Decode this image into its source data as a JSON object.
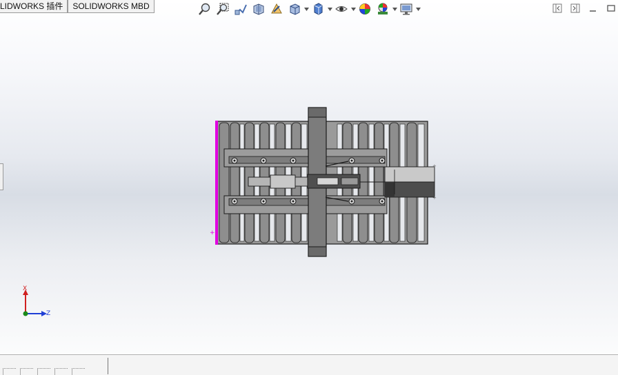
{
  "tabs": [
    {
      "label": "LIDWORKS 插件"
    },
    {
      "label": "SOLIDWORKS MBD"
    }
  ],
  "heads_up_toolbar": {
    "buttons": [
      {
        "icon": "zoom-to-fit-icon"
      },
      {
        "icon": "zoom-to-area-icon"
      },
      {
        "icon": "previous-view-icon"
      },
      {
        "icon": "section-view-icon"
      },
      {
        "icon": "dynamic-annotation-views-icon"
      },
      {
        "icon": "view-orientation-icon"
      },
      {
        "icon": "display-style-icon"
      },
      {
        "icon": "hide-show-items-icon"
      },
      {
        "icon": "edit-appearance-icon"
      },
      {
        "icon": "apply-scene-icon"
      },
      {
        "icon": "view-settings-icon"
      }
    ]
  },
  "window_controls": [
    {
      "icon": "tile-left-icon"
    },
    {
      "icon": "tile-right-icon"
    },
    {
      "icon": "minimize-icon"
    },
    {
      "icon": "maximize-icon"
    }
  ],
  "triad": {
    "x_label": "X",
    "z_label": "Z",
    "colors": {
      "x": "#d02020",
      "y": "#1a8a1a",
      "z": "#1f3fd6"
    }
  },
  "model": {
    "name": "conveyor-assembly",
    "colors": {
      "body": "#8c8c8c",
      "dark": "#5a5a5a",
      "edge": "#1a1a1a",
      "highlight": "#e100e1"
    }
  }
}
